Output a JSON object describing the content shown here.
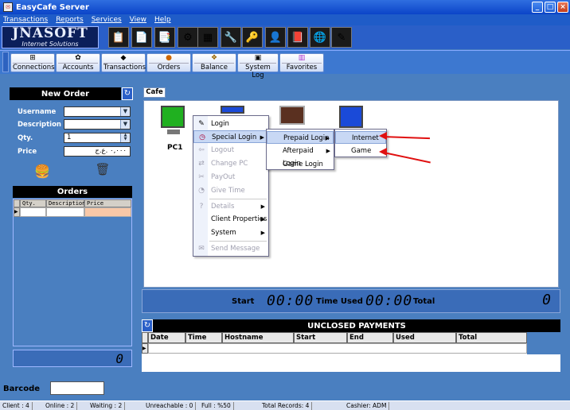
{
  "window": {
    "title": "EasyCafe Server",
    "minimize": "_",
    "maximize": "□",
    "close": "×"
  },
  "menu": [
    "Transactions",
    "Reports",
    "Services",
    "View",
    "Help"
  ],
  "logo": {
    "big": "JNASOFT",
    "small": "Internet Solutions"
  },
  "toolbar_icons": [
    "clipboard-icon",
    "documents-icon",
    "files-icon",
    "gears-icon",
    "calculator-icon",
    "tools-icon",
    "key-icon",
    "user-id-icon",
    "book-icon",
    "globe-icon",
    "pen-icon"
  ],
  "nav": [
    {
      "label": "Connections",
      "icon": "⊞"
    },
    {
      "label": "Accounts",
      "icon": "✿"
    },
    {
      "label": "Transactions",
      "icon": "◆"
    },
    {
      "label": "Orders",
      "icon": "●"
    },
    {
      "label": "Balance",
      "icon": "❖"
    },
    {
      "label": "System Log",
      "icon": "▣"
    },
    {
      "label": "Favorites",
      "icon": "▥"
    }
  ],
  "new_order": {
    "title": "New Order",
    "username_label": "Username",
    "description_label": "Description",
    "qty_label": "Qty.",
    "qty_value": "1",
    "price_label": "Price",
    "price_value": "٠,٠٠٠ .ع.ج"
  },
  "orders": {
    "title": "Orders",
    "columns": [
      "Qty.",
      "Description",
      "Price"
    ],
    "total": "0"
  },
  "cafe_tab": "Cafe",
  "pcs": [
    {
      "name": "PC1"
    }
  ],
  "context_menu": {
    "items": [
      "Login",
      "Special Login",
      "Logout",
      "Change PC",
      "PayOut",
      "Give Time",
      "Details",
      "Client Properties",
      "System",
      "Send Message"
    ],
    "special_login": [
      "Prepaid Login",
      "Afterpaid Login",
      "Game Login"
    ],
    "prepaid": [
      "Internet",
      "Game"
    ]
  },
  "timebar": {
    "start": "Start",
    "start_time": "00:00",
    "time_used": "Time Used",
    "used_time": "00:00",
    "total": "Total",
    "total_value": "0"
  },
  "unclosed": {
    "title": "UNCLOSED PAYMENTS",
    "columns": [
      "Date",
      "Time",
      "Hostname",
      "Start",
      "End",
      "Used",
      "Total"
    ]
  },
  "barcode_label": "Barcode",
  "status": [
    "Client : 4",
    "Online : 2",
    "Waiting : 2",
    "Unreachable : 0",
    "Full : %50",
    "Total Records: 4",
    "Cashier: ADM"
  ]
}
